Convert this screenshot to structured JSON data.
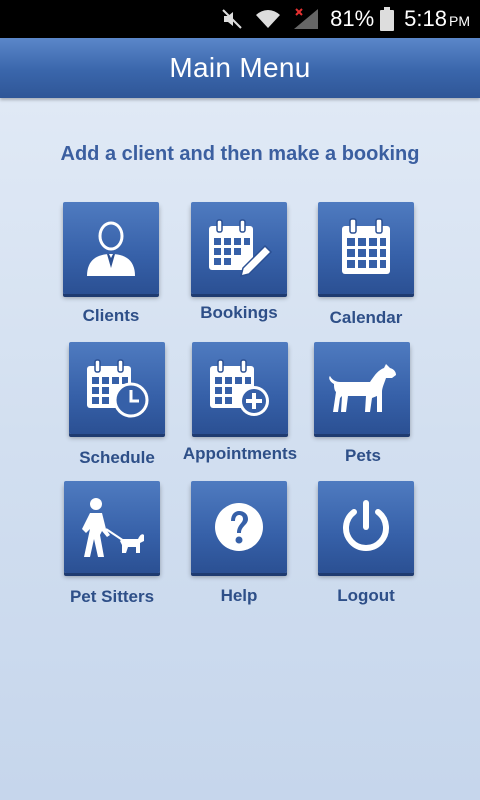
{
  "status_bar": {
    "battery": "81%",
    "time": "5:18",
    "ampm": "PM"
  },
  "header": {
    "title": "Main Menu"
  },
  "subtitle": "Add a client and then make a booking",
  "menu": [
    {
      "label": "Clients",
      "icon": "client-person-icon"
    },
    {
      "label": "Bookings",
      "icon": "calendar-edit-icon"
    },
    {
      "label": "Calendar",
      "icon": "calendar-icon"
    },
    {
      "label": "Schedule",
      "icon": "calendar-clock-icon"
    },
    {
      "label": "Appointments",
      "icon": "calendar-add-icon"
    },
    {
      "label": "Pets",
      "icon": "dog-icon"
    },
    {
      "label": "Pet Sitters",
      "icon": "dog-walker-icon"
    },
    {
      "label": "Help",
      "icon": "help-icon"
    },
    {
      "label": "Logout",
      "icon": "power-icon"
    }
  ],
  "colors": {
    "tile": "#3660a8",
    "label": "#2e4f88",
    "header": "#3a66ab"
  }
}
